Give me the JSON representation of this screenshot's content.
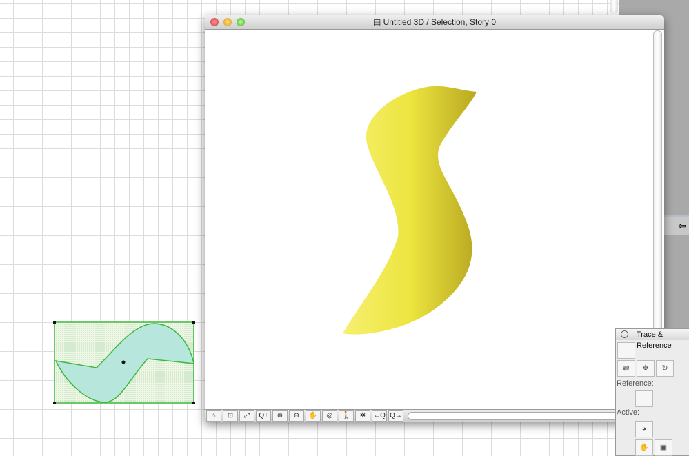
{
  "window": {
    "title": "Untitled 3D / Selection, Story 0"
  },
  "toolbar": {
    "buttons": [
      {
        "name": "3d-view-settings-icon",
        "glyph": "⌂"
      },
      {
        "name": "zoom-window-icon",
        "glyph": "⊡"
      },
      {
        "name": "fit-in-window-icon",
        "glyph": "⤢"
      },
      {
        "name": "zoom-in-out-icon",
        "glyph": "Q±"
      },
      {
        "name": "zoom-in-icon",
        "glyph": "⊕"
      },
      {
        "name": "zoom-out-icon",
        "glyph": "⊖"
      },
      {
        "name": "pan-hand-icon",
        "glyph": "✋"
      },
      {
        "name": "orbit-icon",
        "glyph": "◎"
      },
      {
        "name": "walk-icon",
        "glyph": "🚶"
      },
      {
        "name": "explore-icon",
        "glyph": "✲"
      },
      {
        "name": "previous-zoom-icon",
        "glyph": "←Q"
      },
      {
        "name": "next-zoom-icon",
        "glyph": "Q→"
      }
    ]
  },
  "palette": {
    "title": "Trace & Reference",
    "reference_label": "Reference:",
    "active_label": "Active:"
  },
  "colors": {
    "shape": "#e8e040",
    "selection": "#3cb83c"
  }
}
